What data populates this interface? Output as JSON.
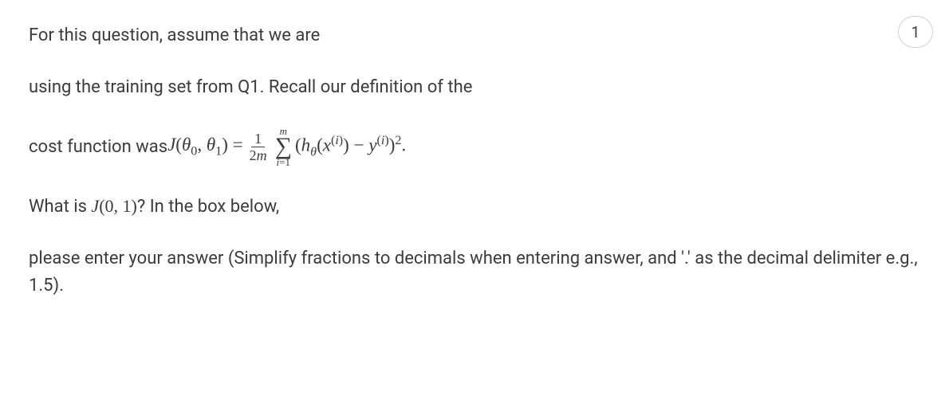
{
  "points": "1",
  "question": {
    "line1": "For this question, assume that we are",
    "line2": "using the training set from Q1. Recall our definition of the",
    "line3_prefix": "cost function was ",
    "line4_prefix": "What is ",
    "line4_suffix": "? In the box below,",
    "line5": "please enter your answer (Simplify fractions to decimals when entering answer, and '.' as the decimal delimiter e.g., 1.5)."
  },
  "formula": {
    "J_label": "J",
    "theta0": "θ",
    "theta0_sub": "0",
    "theta1": "θ",
    "theta1_sub": "1",
    "equals": " = ",
    "frac_num": "1",
    "frac_den_a": "2",
    "frac_den_b": "m",
    "sigma_top": "m",
    "sigma_bot_a": "i",
    "sigma_bot_b": "=1",
    "h_label": "h",
    "h_sub": "θ",
    "x_label": "x",
    "sup_i": "i",
    "minus": " − ",
    "y_label": "y",
    "squared": "2",
    "period": "."
  },
  "J01": {
    "J": "J",
    "arg": "(0, 1)"
  }
}
